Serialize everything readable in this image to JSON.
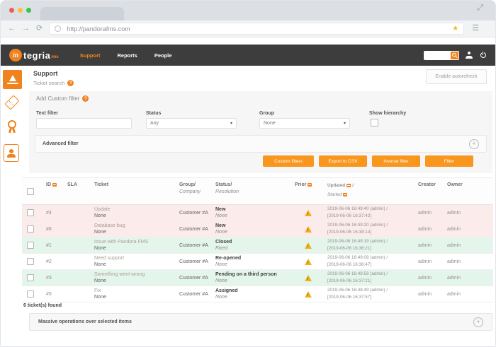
{
  "glyphs": {
    "back": "←",
    "forward": "→",
    "refresh": "⟳",
    "menu": "☰",
    "star": "★",
    "expand": "⤢",
    "plus": "+",
    "question": "?",
    "caret": "▾"
  },
  "colors": {
    "accent": "#f0831e",
    "button_orange": "#f8961e",
    "navbar": "#3d3d3d",
    "row_red": "#fcebeb",
    "row_green": "#e4f5ec",
    "warning": "#f2b01e"
  },
  "browser": {
    "url": "http://pandorafms.com"
  },
  "navbar": {
    "logo": {
      "badge": "in",
      "text": "tegria",
      "suffix": "ims"
    },
    "menu": [
      {
        "label": "Support",
        "active": true
      },
      {
        "label": "Reports",
        "active": false
      },
      {
        "label": "People",
        "active": false
      }
    ],
    "search_value": ""
  },
  "page": {
    "title": "Support",
    "subtitle": "Ticket search",
    "autorefresh_label": "Enable autorefresh"
  },
  "filter": {
    "title": "Add Custom filter",
    "text_filter_label": "Text filter",
    "text_filter_value": "",
    "status_label": "Status",
    "status_value": "Any",
    "group_label": "Group",
    "group_value": "None",
    "show_hierarchy_label": "Show hierarchy",
    "show_hierarchy_checked": false,
    "advanced_label": "Advanced filter",
    "buttons": [
      "Custom filters",
      "Export to CSV",
      "Inverse filter",
      "Filter"
    ]
  },
  "table": {
    "headers": {
      "id": "ID",
      "sla": "SLA",
      "ticket": "Ticket",
      "group": "Group/",
      "company": "Company",
      "status": "Status/",
      "resolution": "Resolution",
      "prior": "Prior",
      "updated": "Updated",
      "updated_sep": "/",
      "started": "Started",
      "creator": "Creator",
      "owner": "Owner"
    },
    "rows": [
      {
        "id": "#4",
        "sla": "",
        "ticket": "Update",
        "ticket_sub": "None",
        "company": "Customer #A",
        "status": "New",
        "resolution": "None",
        "updated": "2019-06-06 16:49:40 (admin) /",
        "started": "[2019-06-06 16:37:42]",
        "creator": "admin",
        "owner": "admin",
        "tone": "red"
      },
      {
        "id": "#6",
        "sla": "",
        "ticket": "Database bug",
        "ticket_sub": "None",
        "company": "Customer #A",
        "status": "New",
        "resolution": "None",
        "updated": "2019-06-06 16:49:20 (admin) /",
        "started": "[2019-06-06 16:38:14]",
        "creator": "admin",
        "owner": "admin",
        "tone": "red"
      },
      {
        "id": "#1",
        "sla": "",
        "ticket": "Issue with Pandora FMS",
        "ticket_sub": "None",
        "company": "Customer #A",
        "status": "Closed",
        "resolution": "Fixed",
        "updated": "2019-06-06 16:49:19 (admin) /",
        "started": "[2019-06-06 16:36:21]",
        "creator": "admin",
        "owner": "admin",
        "tone": "green"
      },
      {
        "id": "#2",
        "sla": "",
        "ticket": "Need support",
        "ticket_sub": "None",
        "company": "Customer #A",
        "status": "Re-opened",
        "resolution": "None",
        "updated": "2019-06-06 16:49:09 (admin) /",
        "started": "[2019-06-06 16:36:47]",
        "creator": "admin",
        "owner": "admin",
        "tone": "white"
      },
      {
        "id": "#3",
        "sla": "",
        "ticket": "Something went wrong",
        "ticket_sub": "None",
        "company": "Customer #A",
        "status": "Pending on a third person",
        "resolution": "None",
        "updated": "2019-06-06 16:48:59 (admin) /",
        "started": "[2019-06-06 16:37:21]",
        "creator": "admin",
        "owner": "admin",
        "tone": "green"
      },
      {
        "id": "#5",
        "sla": "",
        "ticket": "Fix",
        "ticket_sub": "None",
        "company": "Customer #A",
        "status": "Assigned",
        "resolution": "None",
        "updated": "2019-06-06 16:48:49 (admin) /",
        "started": "[2019-06-06 16:37:57]",
        "creator": "admin",
        "owner": "admin",
        "tone": "white"
      }
    ],
    "summary": "6 ticket(s) found"
  },
  "massive": {
    "label": "Massive operations over selected items"
  }
}
